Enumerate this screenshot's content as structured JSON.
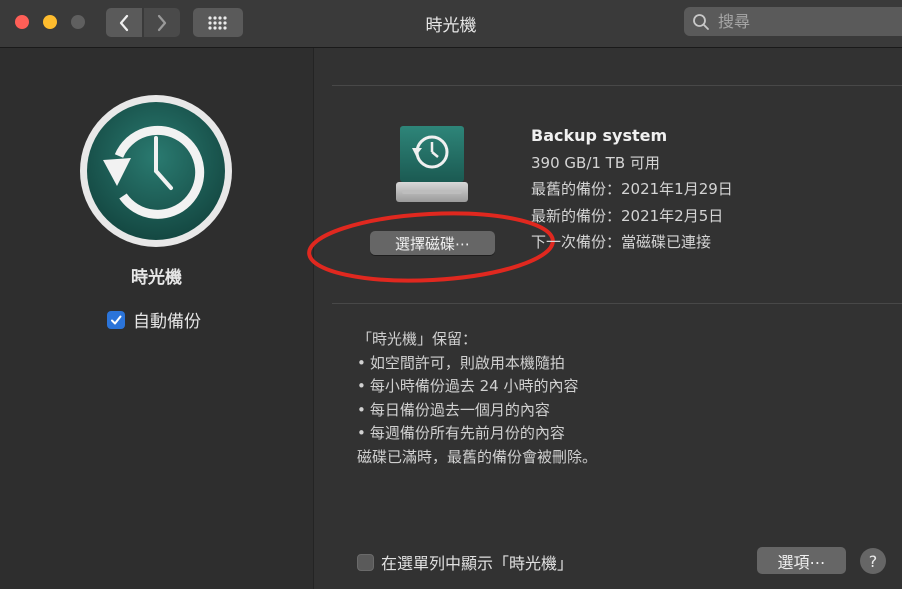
{
  "window": {
    "title": "時光機",
    "search_placeholder": "搜尋"
  },
  "sidebar": {
    "icon": "time-machine-icon",
    "title": "時光機",
    "auto_backup_label": "自動備份",
    "auto_backup_checked": true
  },
  "disk": {
    "icon": "backup-drive-icon",
    "choose_button": "選擇磁碟⋯",
    "name": "Backup system",
    "capacity": "390 GB/1 TB 可用",
    "oldest_backup": "最舊的備份：2021年1月29日",
    "latest_backup": "最新的備份：2021年2月5日",
    "next_backup": "下一次備份：當磁碟已連接"
  },
  "keeps": {
    "heading": "「時光機」保留：",
    "items": [
      "如空間許可，則啟用本機隨拍",
      "每小時備份過去 24 小時的內容",
      "每日備份過去一個月的內容",
      "每週備份所有先前月份的內容"
    ],
    "footer": "磁碟已滿時，最舊的備份會被刪除。"
  },
  "bottom": {
    "menubar_label": "在選單列中顯示「時光機」",
    "menubar_checked": false,
    "options_button": "選項⋯",
    "help_button": "?"
  },
  "colors": {
    "annotation_circle": "#e0281f",
    "checkbox_accent": "#2b74d9",
    "time_machine_green": "#1f5c54"
  }
}
